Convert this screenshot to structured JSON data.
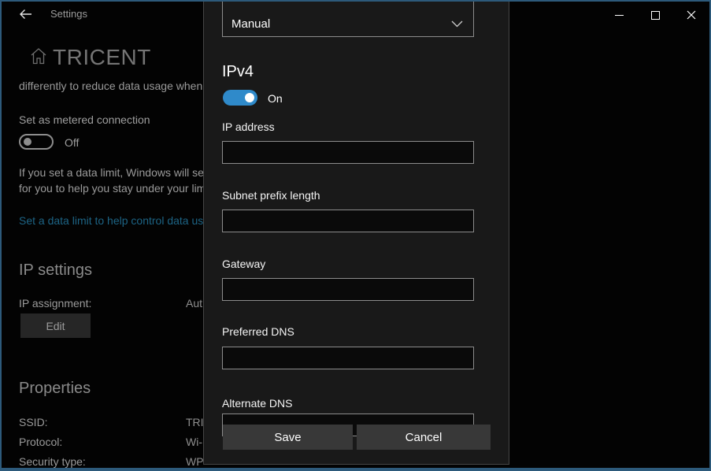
{
  "window": {
    "title": "Settings"
  },
  "page": {
    "title": "TRICENT",
    "intro_text": "differently to reduce data usage when",
    "metered": {
      "label": "Set as metered connection",
      "toggle_state": "Off"
    },
    "data_limit_text_line1": "If you set a data limit, Windows will se",
    "data_limit_text_line2": "for you to help you stay under your lim",
    "data_limit_link": "Set a data limit to help control data us",
    "ip_settings": {
      "heading": "IP settings",
      "assignment_label": "IP assignment:",
      "assignment_value": "Aut",
      "edit_button": "Edit"
    },
    "properties": {
      "heading": "Properties",
      "rows": [
        {
          "label": "SSID:",
          "value": "TRI"
        },
        {
          "label": "Protocol:",
          "value": "Wi-"
        },
        {
          "label": "Security type:",
          "value": "WP"
        }
      ]
    }
  },
  "dialog": {
    "ip_assignment_dropdown": "Manual",
    "ipv4_heading": "IPv4",
    "ipv4_toggle_state": "On",
    "fields": [
      {
        "label": "IP address",
        "value": ""
      },
      {
        "label": "Subnet prefix length",
        "value": ""
      },
      {
        "label": "Gateway",
        "value": ""
      },
      {
        "label": "Preferred DNS",
        "value": ""
      },
      {
        "label": "Alternate DNS",
        "value": ""
      }
    ],
    "save_button": "Save",
    "cancel_button": "Cancel"
  },
  "colors": {
    "accent_toggle": "#2f8aca",
    "window_border": "#2d5a7b",
    "link": "#1d6485",
    "dialog_background": "#191919",
    "page_background": "#030303"
  }
}
